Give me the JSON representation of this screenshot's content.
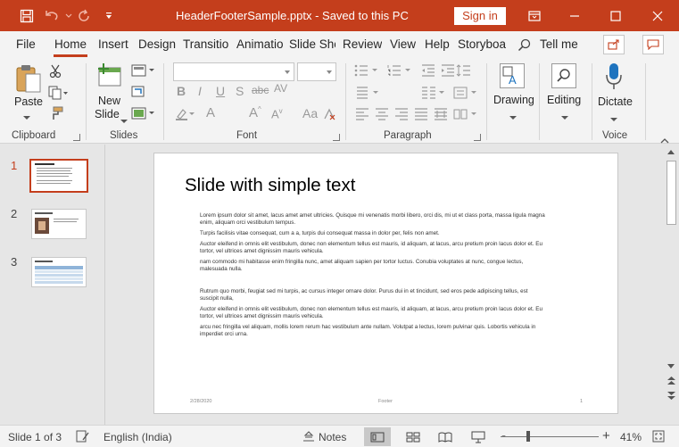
{
  "titlebar": {
    "title": "HeaderFooterSample.pptx  -  Saved to this PC",
    "signin_label": "Sign in"
  },
  "tabs": [
    {
      "label": "File"
    },
    {
      "label": "Home"
    },
    {
      "label": "Insert"
    },
    {
      "label": "Design"
    },
    {
      "label": "Transitio"
    },
    {
      "label": "Animatio"
    },
    {
      "label": "Slide Sho"
    },
    {
      "label": "Review"
    },
    {
      "label": "View"
    },
    {
      "label": "Help"
    },
    {
      "label": "Storyboa"
    }
  ],
  "tell_me": "Tell me",
  "ribbon": {
    "clipboard": {
      "paste": "Paste",
      "label": "Clipboard"
    },
    "slides": {
      "new_slide_1": "New",
      "new_slide_2": "Slide",
      "label": "Slides"
    },
    "font": {
      "label": "Font"
    },
    "paragraph": {
      "label": "Paragraph"
    },
    "drawing": {
      "label": "Drawing"
    },
    "editing": {
      "label": "Editing"
    },
    "voice": {
      "dictate": "Dictate",
      "label": "Voice"
    }
  },
  "thumbnails": [
    {
      "num": "1",
      "selected": true
    },
    {
      "num": "2",
      "selected": false
    },
    {
      "num": "3",
      "selected": false
    }
  ],
  "slide": {
    "title": "Slide with simple text",
    "paragraphs": [
      "Lorem ipsum dolor sit amet, lacus amet amet ultricies. Quisque mi venenatis morbi libero, orci dis, mi ut et class porta, massa ligula magna enim, aliquam orci vestibulum tempus.",
      "Turpis facilisis vitae consequat, cum a a, turpis dui consequat massa in dolor per, felis non amet.",
      "Auctor eleifend in omnis elit vestibulum, donec non elementum tellus est mauris, id aliquam, at lacus, arcu pretium proin lacus dolor et. Eu tortor, vel ultrices amet dignissim mauris vehicula.",
      "nam commodo mi habitasse enim fringilla nunc, amet aliquam sapien per tortor luctus. Conubia voluptates at nunc, congue lectus, malesuada nulla.",
      "Rutrum quo morbi, feugiat sed mi turpis, ac cursus integer ornare dolor. Purus dui in et tincidunt, sed eros pede adipiscing tellus, est suscipit nulla,",
      "Auctor eleifend in omnis elit vestibulum, donec non elementum tellus est mauris, id aliquam, at lacus, arcu pretium proin lacus dolor et. Eu tortor, vel ultrices amet dignissim mauris vehicula.",
      "arcu nec fringilla vel aliquam, mollis lorem rerum hac vestibulum ante nullam. Volutpat a lectus, lorem pulvinar quis. Lobortis vehicula in imperdiet orci urna."
    ],
    "footer_date": "2/28/2020",
    "footer_text": "Footer",
    "footer_page": "1"
  },
  "status": {
    "slide_info": "Slide 1 of 3",
    "language": "English (India)",
    "notes": "Notes",
    "zoom": "41%",
    "zoom_minus": "-",
    "zoom_plus": "+"
  },
  "colors": {
    "accent": "#c43e1c"
  },
  "icons": [
    "save-icon",
    "undo-icon",
    "redo-icon",
    "customize-icon",
    "ribbon-display-icon",
    "minimize-icon",
    "maximize-icon",
    "close-icon",
    "search-icon",
    "share-icon",
    "comments-icon"
  ]
}
